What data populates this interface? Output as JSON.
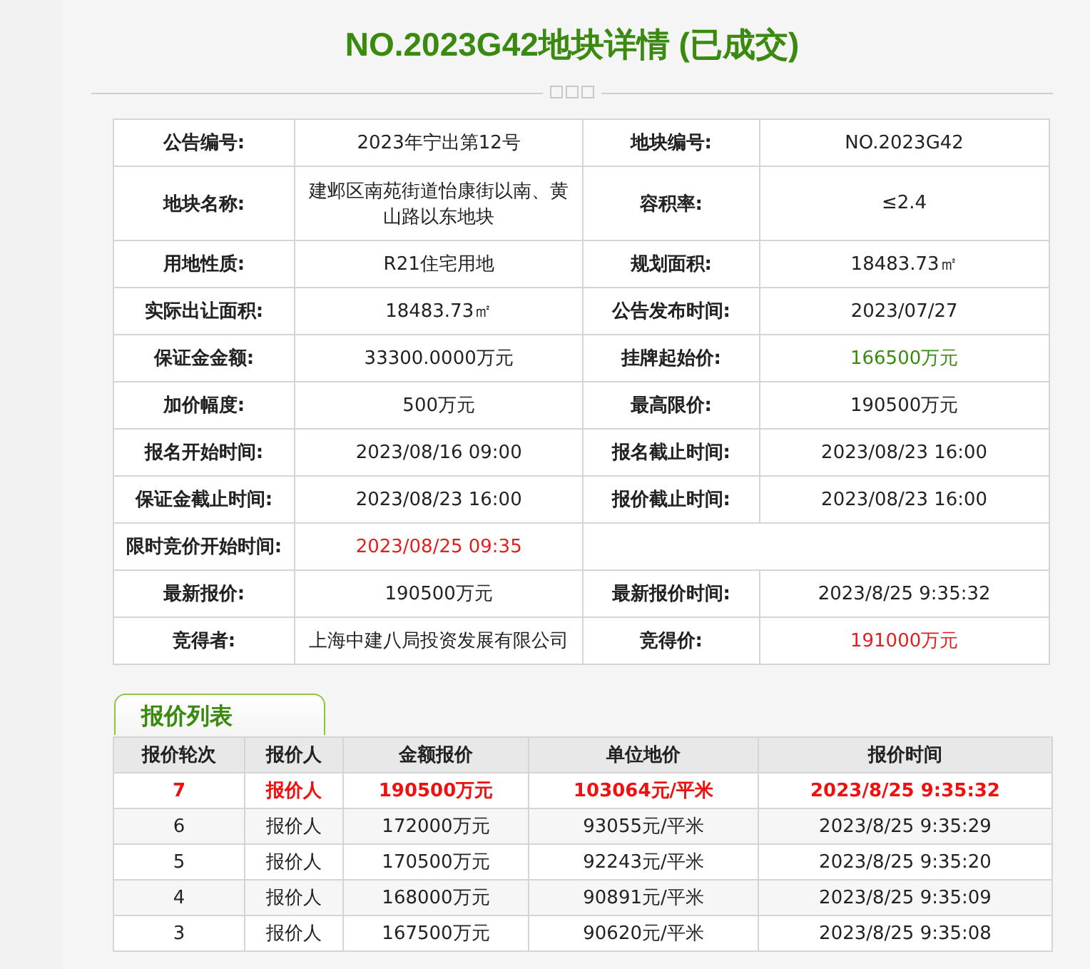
{
  "title": "NO.2023G42地块详情 (已成交)",
  "details": [
    [
      {
        "label": "公告编号:",
        "value": "2023年宁出第12号"
      },
      {
        "label": "地块编号:",
        "value": "NO.2023G42"
      }
    ],
    [
      {
        "label": "地块名称:",
        "value": "建邺区南苑街道怡康街以南、黄山路以东地块"
      },
      {
        "label": "容积率:",
        "value": "≤2.4"
      }
    ],
    [
      {
        "label": "用地性质:",
        "value": "R21住宅用地"
      },
      {
        "label": "规划面积:",
        "value": "18483.73㎡"
      }
    ],
    [
      {
        "label": "实际出让面积:",
        "value": "18483.73㎡"
      },
      {
        "label": "公告发布时间:",
        "value": "2023/07/27"
      }
    ],
    [
      {
        "label": "保证金金额:",
        "value": "33300.0000万元"
      },
      {
        "label": "挂牌起始价:",
        "value": "166500万元",
        "color": "#3a8a10"
      }
    ],
    [
      {
        "label": "加价幅度:",
        "value": "500万元"
      },
      {
        "label": "最高限价:",
        "value": "190500万元"
      }
    ],
    [
      {
        "label": "报名开始时间:",
        "value": "2023/08/16 09:00"
      },
      {
        "label": "报名截止时间:",
        "value": "2023/08/23 16:00"
      }
    ],
    [
      {
        "label": "保证金截止时间:",
        "value": "2023/08/23 16:00"
      },
      {
        "label": "报价截止时间:",
        "value": "2023/08/23 16:00"
      }
    ],
    [
      {
        "label": "限时竞价开始时间:",
        "value": "2023/08/25 09:35",
        "color": "#e02020"
      }
    ],
    [
      {
        "label": "最新报价:",
        "value": "190500万元"
      },
      {
        "label": "最新报价时间:",
        "value": "2023/8/25 9:35:32"
      }
    ],
    [
      {
        "label": "竞得者:",
        "value": "上海中建八局投资发展有限公司"
      },
      {
        "label": "竞得价:",
        "value": "191000万元",
        "color": "#e02020"
      }
    ]
  ],
  "bids": {
    "tab": "报价列表",
    "columns": [
      "报价轮次",
      "报价人",
      "金额报价",
      "单位地价",
      "报价时间"
    ],
    "rows": [
      {
        "latest": true,
        "cells": [
          "7",
          "报价人",
          "190500万元",
          "103064元/平米",
          "2023/8/25 9:35:32"
        ]
      },
      {
        "latest": false,
        "cells": [
          "6",
          "报价人",
          "172000万元",
          "93055元/平米",
          "2023/8/25 9:35:29"
        ]
      },
      {
        "latest": false,
        "cells": [
          "5",
          "报价人",
          "170500万元",
          "92243元/平米",
          "2023/8/25 9:35:20"
        ]
      },
      {
        "latest": false,
        "cells": [
          "4",
          "报价人",
          "168000万元",
          "90891元/平米",
          "2023/8/25 9:35:09"
        ]
      },
      {
        "latest": false,
        "cells": [
          "3",
          "报价人",
          "167500万元",
          "90620元/平米",
          "2023/8/25 9:35:08"
        ]
      }
    ]
  }
}
